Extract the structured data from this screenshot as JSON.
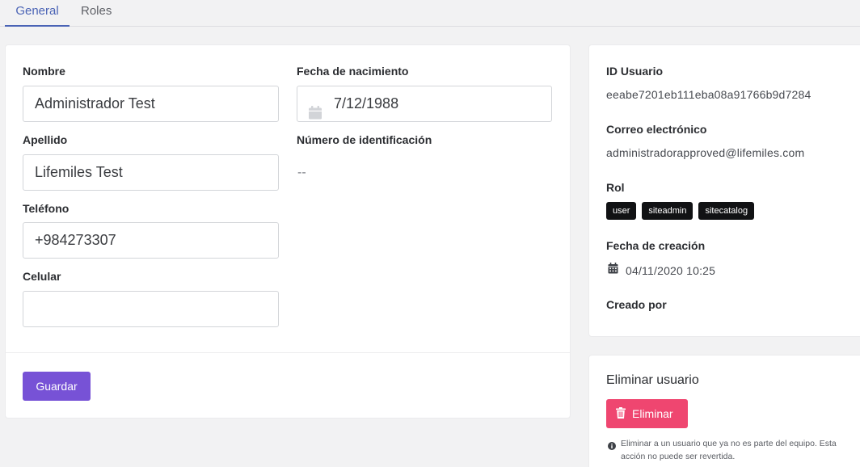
{
  "tabs": [
    {
      "label": "General",
      "active": true
    },
    {
      "label": "Roles",
      "active": false
    }
  ],
  "form": {
    "nombre": {
      "label": "Nombre",
      "value": "Administrador Test"
    },
    "fecha_nacimiento": {
      "label": "Fecha de nacimiento",
      "value": "7/12/1988"
    },
    "apellido": {
      "label": "Apellido",
      "value": "Lifemiles Test"
    },
    "numero_identificacion": {
      "label": "Número de identificación",
      "value": "--"
    },
    "telefono": {
      "label": "Teléfono",
      "value": "+984273307"
    },
    "celular": {
      "label": "Celular",
      "value": ""
    },
    "save_label": "Guardar"
  },
  "info": {
    "id_label": "ID Usuario",
    "id_value": "eeabe7201eb111eba08a91766b9d7284",
    "email_label": "Correo electrónico",
    "email_value": "administradorapproved@lifemiles.com",
    "rol_label": "Rol",
    "roles": [
      "user",
      "siteadmin",
      "sitecatalog"
    ],
    "created_label": "Fecha de creación",
    "created_value": "04/11/2020 10:25",
    "created_by_label": "Creado por"
  },
  "delete": {
    "title": "Eliminar usuario",
    "button_label": "Eliminar",
    "note": "Eliminar a un usuario que ya no es parte del equipo. Esta acción no puede ser revertida."
  },
  "colors": {
    "accent": "#4a63b5",
    "primary_button": "#7752d6",
    "danger_button": "#ef4670",
    "badge": "#111214"
  },
  "icons": [
    "calendar-icon",
    "trash-icon",
    "info-icon"
  ]
}
